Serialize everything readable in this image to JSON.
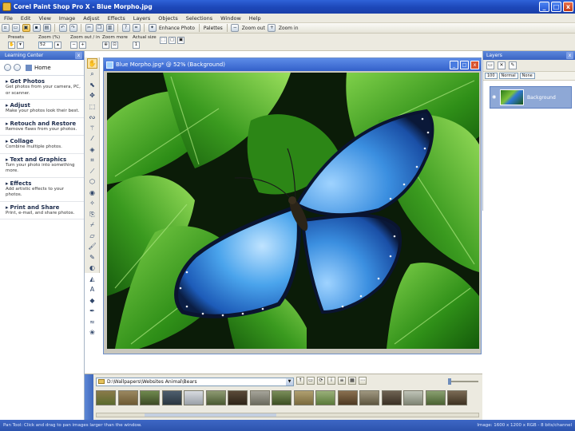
{
  "window": {
    "title": "Corel Paint Shop Pro X - Blue Morpho.jpg",
    "buttons": {
      "minimize": "_",
      "maximize": "□",
      "close": "x"
    }
  },
  "menu": [
    "File",
    "Edit",
    "View",
    "Image",
    "Adjust",
    "Effects",
    "Layers",
    "Objects",
    "Selections",
    "Window",
    "Help"
  ],
  "toolbar": {
    "enhance_photo": "Enhance Photo",
    "palettes": "Palettes",
    "zoom_out": "Zoom out",
    "zoom_in": "Zoom in"
  },
  "tool_options": {
    "presets": "Presets",
    "zoom_percent_label": "Zoom (%)",
    "zoom_value": "52",
    "zoom_out_in": "Zoom out / in",
    "zoom_more": "Zoom more",
    "actual_size": "Actual size"
  },
  "learning_center": {
    "title": "Learning Center",
    "home": "Home",
    "items": [
      {
        "title": "Get Photos",
        "desc": "Get photos from your camera, PC, or scanner."
      },
      {
        "title": "Adjust",
        "desc": "Make your photos look their best."
      },
      {
        "title": "Retouch and Restore",
        "desc": "Remove flaws from your photos."
      },
      {
        "title": "Collage",
        "desc": "Combine multiple photos."
      },
      {
        "title": "Text and Graphics",
        "desc": "Turn your photo into something more."
      },
      {
        "title": "Effects",
        "desc": "Add artistic effects to your photos."
      },
      {
        "title": "Print and Share",
        "desc": "Print, e-mail, and share photos."
      }
    ]
  },
  "tools": [
    "pan-icon",
    "zoom-icon",
    "pick-icon",
    "move-icon",
    "selection-icon",
    "freehand-selection-icon",
    "magic-wand-icon",
    "dropper-icon",
    "color-changer-icon",
    "crop-icon",
    "straighten-icon",
    "perspective-icon",
    "red-eye-icon",
    "makeover-icon",
    "clone-brush-icon",
    "scratch-remover-icon",
    "eraser-icon",
    "paint-brush-icon",
    "airbrush-icon",
    "lighten-darken-icon",
    "flood-fill-icon",
    "text-icon",
    "preset-shape-icon",
    "pen-icon",
    "warp-brush-icon",
    "picture-tube-icon"
  ],
  "document": {
    "title": "Blue Morpho.jpg* @ 52% (Background)"
  },
  "organizer": {
    "path": "D:\\Wallpapers\\Websites Animal\\Bears",
    "thumb_count": 18
  },
  "layers": {
    "title": "Layers",
    "opacity": "100",
    "blend": "Normal",
    "mode": "None",
    "layer_name": "Background"
  },
  "status": {
    "left": "Pan Tool: Click and drag to pan images larger than the window.",
    "right": "Image: 1600 x 1200 x RGB - 8 bits/channel"
  },
  "colors": {
    "titlebar": "#2456d4",
    "panel_header": "#3a64c2",
    "butterfly": "#3b8fe0",
    "leaves": "#3a9a1f"
  }
}
